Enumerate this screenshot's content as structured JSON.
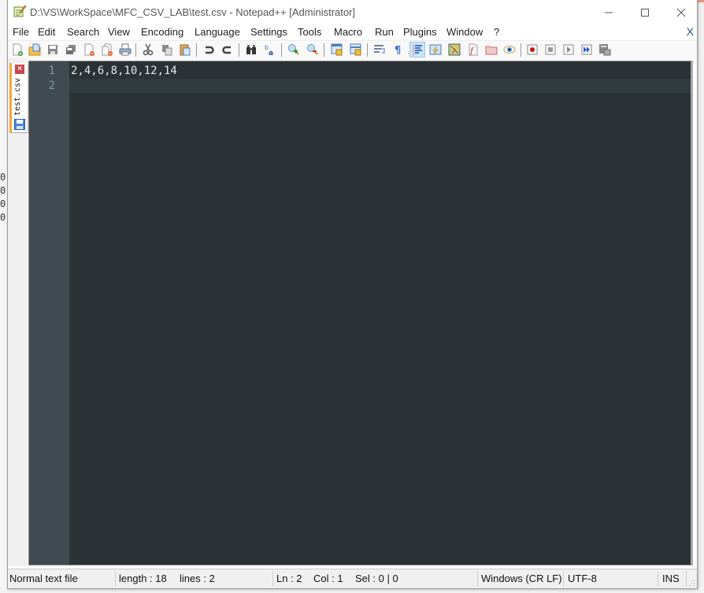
{
  "background": {
    "left_chars": [
      "0",
      "0",
      "0",
      "0"
    ]
  },
  "window": {
    "title": "D:\\VS\\WorkSpace\\MFC_CSV_LAB\\test.csv - Notepad++ [Administrator]",
    "controls": {
      "minimize": "minimize-icon",
      "maximize": "maximize-icon",
      "close": "close-icon"
    }
  },
  "menubar": {
    "items": [
      "File",
      "Edit",
      "Search",
      "View",
      "Encoding",
      "Language",
      "Settings",
      "Tools",
      "Macro",
      "Run",
      "Plugins",
      "Window",
      "?"
    ],
    "close_doc": "X"
  },
  "toolbar": {
    "buttons": [
      "new-file",
      "open-file",
      "save",
      "save-all",
      "close",
      "close-all",
      "print",
      "cut",
      "copy",
      "paste",
      "undo",
      "redo",
      "find",
      "replace",
      "zoom-in",
      "zoom-out",
      "sync-vertical",
      "sync-horizontal",
      "word-wrap",
      "show-all-chars",
      "indent-guide",
      "user-defined-language",
      "document-map",
      "function-list",
      "folder-as-workspace",
      "monitoring",
      "start-recording",
      "stop-recording",
      "playback",
      "run-macro-multiple",
      "save-macro"
    ],
    "active": "indent-guide"
  },
  "tabs": [
    {
      "label": "test.csv",
      "saved": true,
      "active": true
    }
  ],
  "editor": {
    "lines": [
      "2,4,6,8,10,12,14",
      ""
    ],
    "current_line": 2,
    "colors": {
      "background": "#2b3235",
      "gutter": "#3f4b50",
      "text": "#e6e6e6",
      "line_number": "#7f9aa3"
    }
  },
  "statusbar": {
    "file_type": "Normal text file",
    "length": "length : 18",
    "lines": "lines : 2",
    "ln": "Ln : 2",
    "col": "Col : 1",
    "sel": "Sel : 0 | 0",
    "eol": "Windows (CR LF)",
    "encoding": "UTF-8",
    "mode": "INS"
  }
}
